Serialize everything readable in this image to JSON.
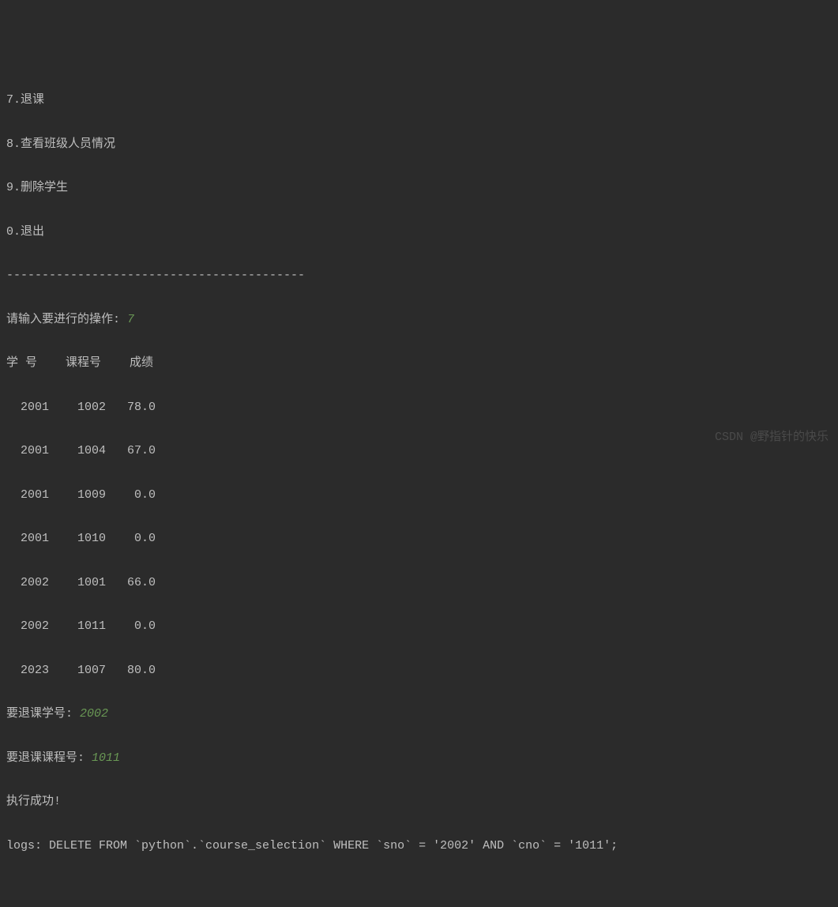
{
  "menu": {
    "item7": "7.退课",
    "item8": "8.查看班级人员情况",
    "item9": "9.删除学生",
    "item0": "0.退出"
  },
  "separator": "------------------------------------------",
  "prompts": {
    "operation": "请输入要进行的操作: ",
    "operation_input": "7",
    "drop_sno_label": "要退课学号: ",
    "drop_sno_input": "2002",
    "drop_cno_label": "要退课课程号: ",
    "drop_cno_input": "1011"
  },
  "table": {
    "header": "学 号    课程号    成绩",
    "rows": [
      "  2001    1002   78.0",
      "  2001    1004   67.0",
      "  2001    1009    0.0",
      "  2001    1010    0.0",
      "  2002    1001   66.0",
      "  2002    1011    0.0",
      "  2023    1007   80.0"
    ]
  },
  "result": {
    "success": "执行成功!",
    "log": "logs: DELETE FROM `python`.`course_selection` WHERE `sno` = '2002' AND `cno` = '1011';"
  },
  "watermark": "CSDN @野指针的快乐"
}
